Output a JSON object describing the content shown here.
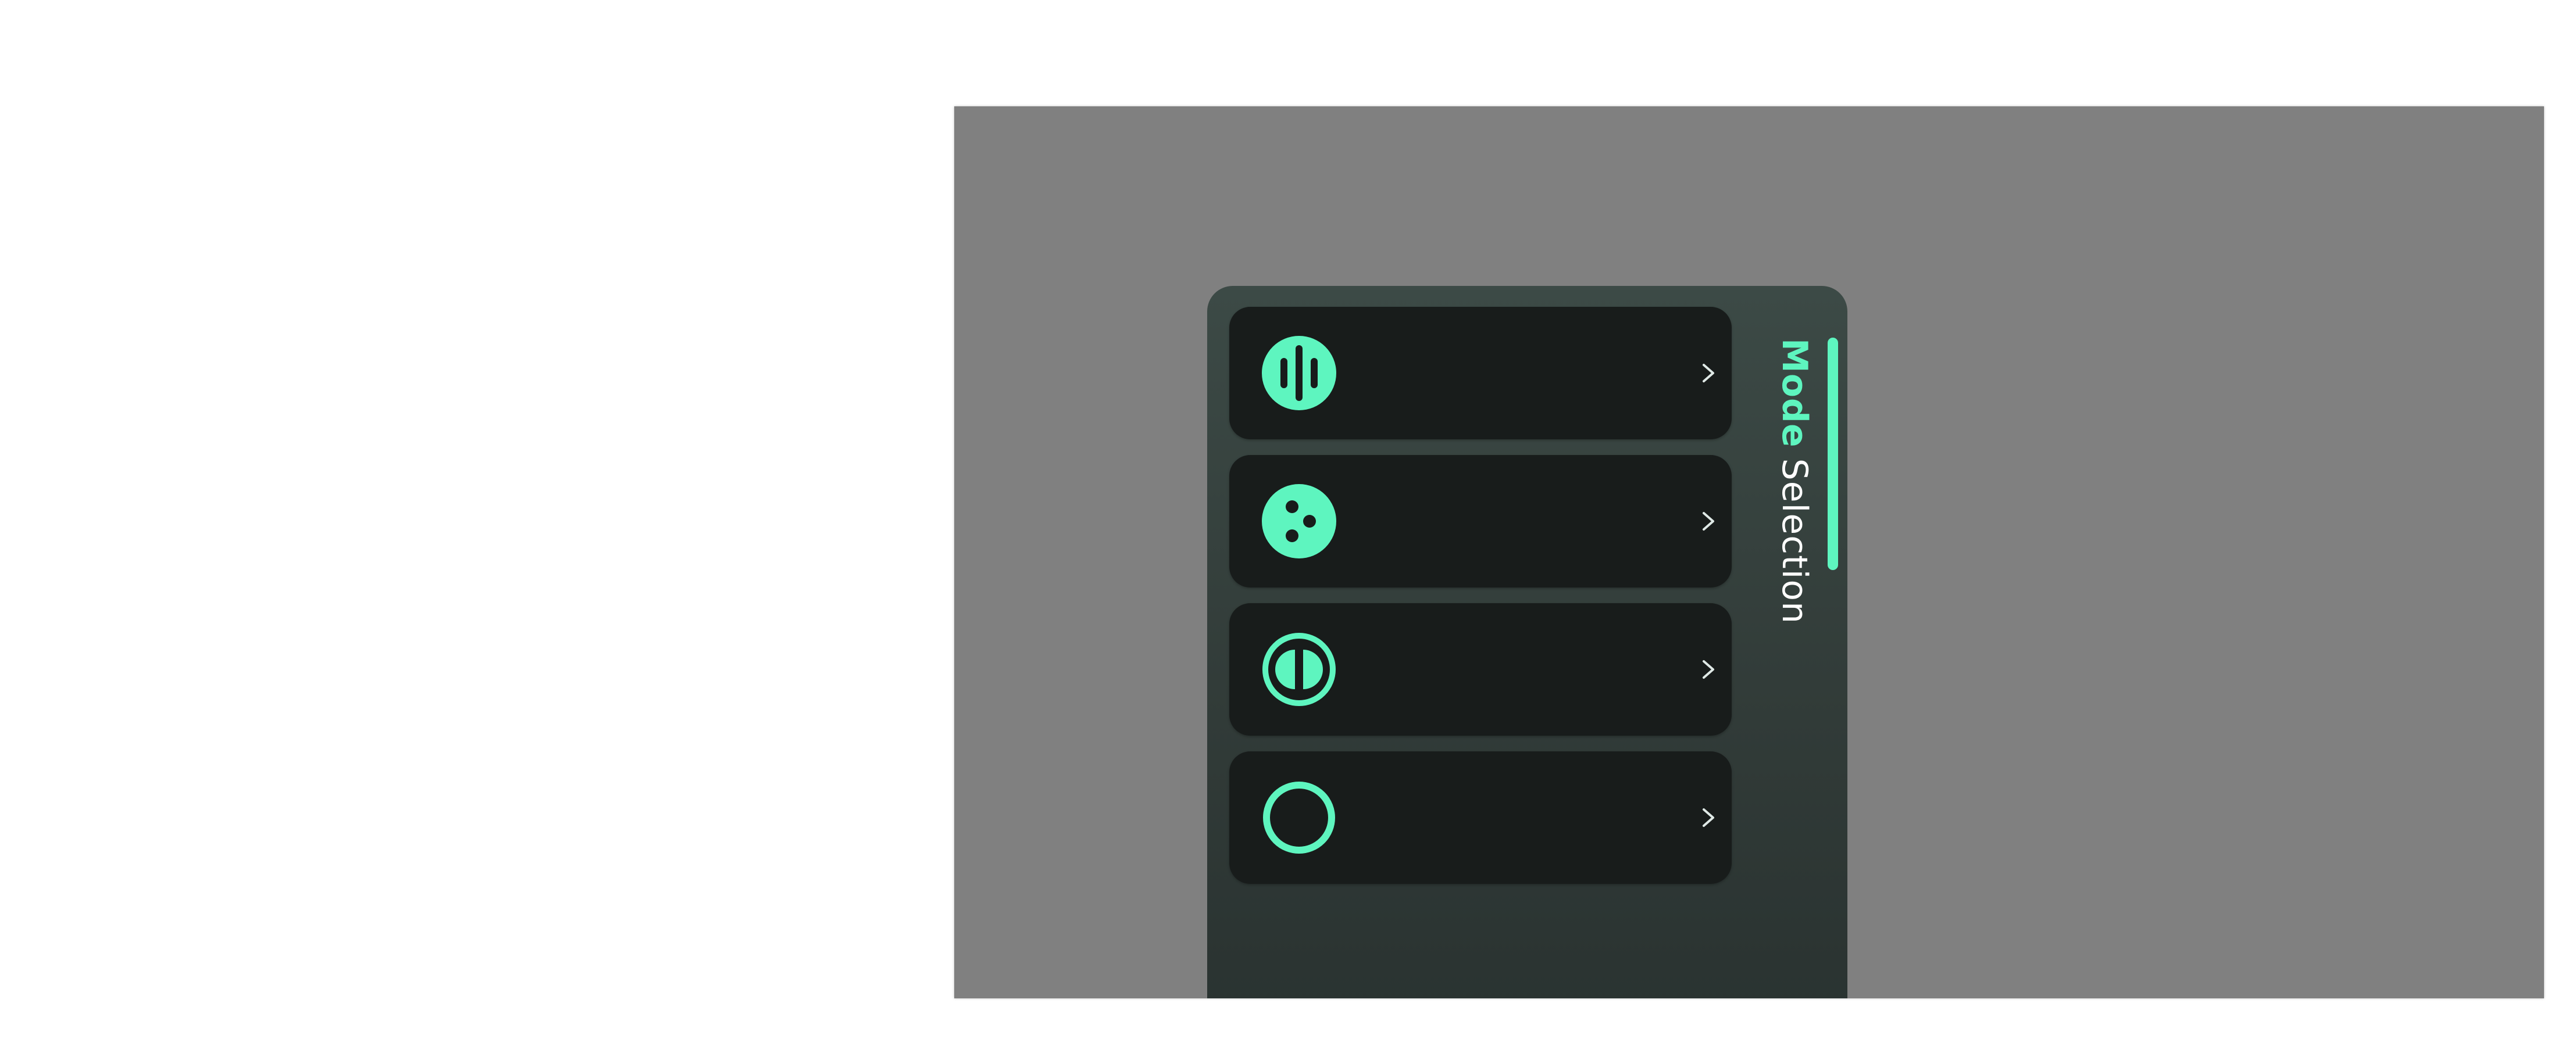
{
  "colors": {
    "accent": "#5ef5bf",
    "overlay": "#808080",
    "panel": "#323c39",
    "card": "#181c1b",
    "title_text": "#ffffff"
  },
  "panel": {
    "title_strong": "Mode",
    "title_rest": "Selection"
  },
  "modes": [
    {
      "icon": "equalizer-bars-icon",
      "action_icon": "chevron-right-icon"
    },
    {
      "icon": "three-dots-icon",
      "action_icon": "chevron-right-icon"
    },
    {
      "icon": "split-circle-icon",
      "action_icon": "chevron-right-icon"
    },
    {
      "icon": "ring-icon",
      "action_icon": "chevron-right-icon"
    }
  ]
}
